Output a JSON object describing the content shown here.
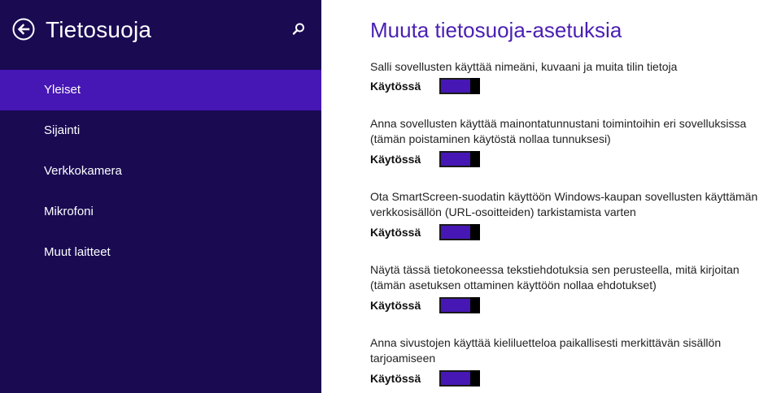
{
  "sidebar": {
    "title": "Tietosuoja",
    "items": [
      {
        "label": "Yleiset",
        "active": true
      },
      {
        "label": "Sijainti",
        "active": false
      },
      {
        "label": "Verkkokamera",
        "active": false
      },
      {
        "label": "Mikrofoni",
        "active": false
      },
      {
        "label": "Muut laitteet",
        "active": false
      }
    ]
  },
  "main": {
    "title": "Muuta tietosuoja-asetuksia",
    "settings": [
      {
        "line1": "Salli sovellusten käyttää nimeäni, kuvaani ja muita tilin tietoja",
        "line2": "",
        "state_label": "Käytössä",
        "on": true
      },
      {
        "line1": "Anna sovellusten käyttää mainontatunnustani toimintoihin eri sovelluksissa",
        "line2": "(tämän poistaminen käytöstä nollaa tunnuksesi)",
        "state_label": "Käytössä",
        "on": true
      },
      {
        "line1": "Ota SmartScreen-suodatin käyttöön Windows-kaupan sovellusten käyttämän",
        "line2": "verkkosisällön (URL-osoitteiden) tarkistamista varten",
        "state_label": "Käytössä",
        "on": true
      },
      {
        "line1": "Näytä tässä tietokoneessa tekstiehdotuksia sen perusteella, mitä kirjoitan",
        "line2": "(tämän asetuksen ottaminen käyttöön nollaa ehdotukset)",
        "state_label": "Käytössä",
        "on": true
      },
      {
        "line1": "Anna sivustojen käyttää kieliluetteloa paikallisesti merkittävän sisällön",
        "line2": "tarjoamiseen",
        "state_label": "Käytössä",
        "on": true
      }
    ]
  },
  "icons": {
    "back": "back-arrow-icon",
    "search": "search-icon"
  },
  "colors": {
    "sidebar_bg": "#1a0a52",
    "accent": "#4617b4",
    "title_color": "#4a1fb3"
  }
}
